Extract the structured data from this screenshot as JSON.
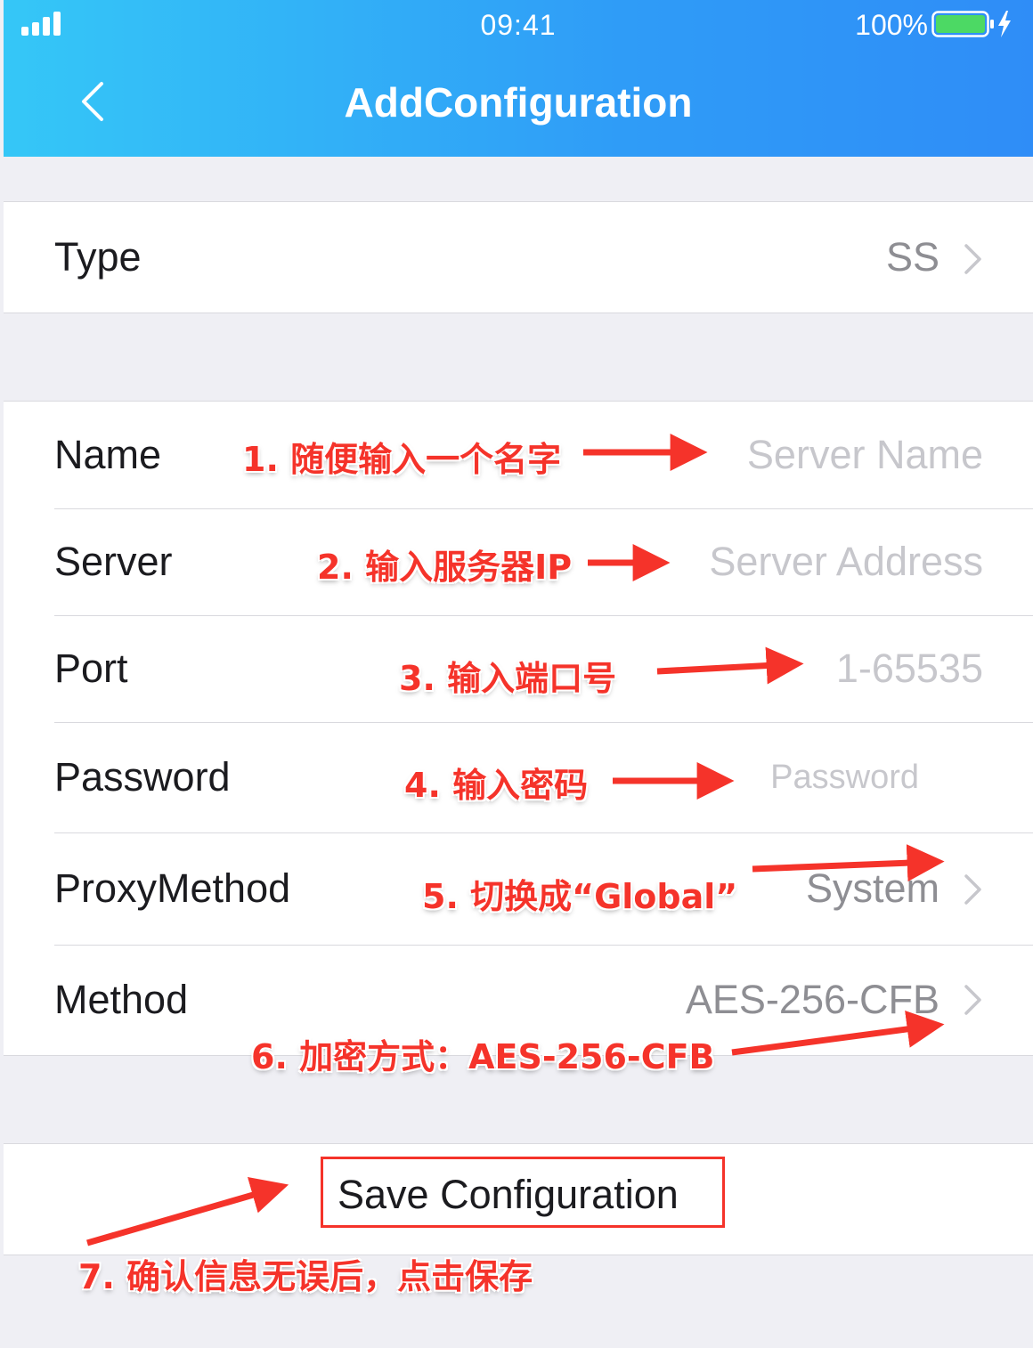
{
  "status_bar": {
    "time": "09:41",
    "battery_percent": "100%"
  },
  "nav": {
    "title": "AddConfiguration"
  },
  "type_row": {
    "label": "Type",
    "value": "SS"
  },
  "fields": {
    "name": {
      "label": "Name",
      "placeholder": "Server Name"
    },
    "server": {
      "label": "Server",
      "placeholder": "Server Address"
    },
    "port": {
      "label": "Port",
      "placeholder": "1-65535"
    },
    "password": {
      "label": "Password",
      "placeholder": "Password"
    },
    "proxy_method": {
      "label": "ProxyMethod",
      "value": "System"
    },
    "method": {
      "label": "Method",
      "value": "AES-256-CFB"
    }
  },
  "save_button": {
    "label": "Save Configuration"
  },
  "annotations": [
    "1. 随便输入一个名字",
    "2. 输入服务器IP",
    "3. 输入端口号",
    "4. 输入密码",
    "5. 切换成“Global”",
    "6. 加密方式：AES-256-CFB",
    "7. 确认信息无误后，点击保存"
  ],
  "colors": {
    "header_start": "#35c7f7",
    "header_end": "#2f8df7",
    "annotation": "#f5332a",
    "battery": "#4cd964"
  },
  "icons": [
    "signal-icon",
    "battery-icon",
    "charging-icon",
    "back-chevron-icon",
    "chevron-right-icon"
  ]
}
